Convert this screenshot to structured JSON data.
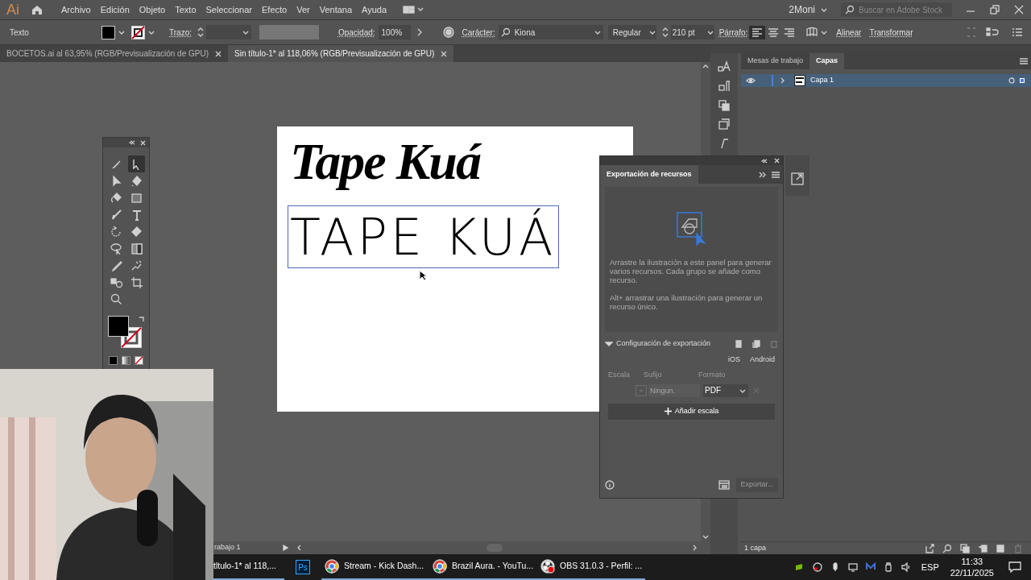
{
  "app_logo": "Ai",
  "menu": [
    "Archivo",
    "Edición",
    "Objeto",
    "Texto",
    "Seleccionar",
    "Efecto",
    "Ver",
    "Ventana",
    "Ayuda"
  ],
  "workspace": "2Moni",
  "stock_search": {
    "placeholder": "Buscar en Adobe Stock"
  },
  "control_bar": {
    "selection": "Texto",
    "stroke_label": "Trazo:",
    "opacity_label": "Opacidad:",
    "opacity": "100%",
    "character_label": "Carácter:",
    "font": "Kiona",
    "style": "Regular",
    "size": "210 pt",
    "paragraph_label": "Párrafo:",
    "align": [
      {
        "kind": "left",
        "selected": true
      },
      {
        "kind": "center",
        "selected": false
      },
      {
        "kind": "right",
        "selected": false
      }
    ],
    "align_link": "Alinear",
    "transform_link": "Transformar"
  },
  "doc_tabs": [
    {
      "label": "BOCETOS.ai al 63,95% (RGB/Previsualización de GPU)",
      "selected": false
    },
    {
      "label": "Sin título-1* al 118,06% (RGB/Previsualización de GPU)",
      "selected": true
    }
  ],
  "artboard": {
    "script_title": "Tape Kuá",
    "caps_title": "TAPE KUÁ"
  },
  "tools": [
    {
      "kind": "shaper",
      "selected": false
    },
    {
      "kind": "direct",
      "selected": true
    },
    {
      "kind": "select",
      "selected": false
    },
    {
      "kind": "pen",
      "selected": false
    },
    {
      "kind": "curvature",
      "selected": false
    },
    {
      "kind": "rect",
      "selected": false
    },
    {
      "kind": "brush",
      "selected": false
    },
    {
      "kind": "type",
      "selected": false
    },
    {
      "kind": "rotate",
      "selected": false
    },
    {
      "kind": "eraser",
      "selected": false
    },
    {
      "kind": "lasso",
      "selected": false
    },
    {
      "kind": "gradient",
      "selected": false
    },
    {
      "kind": "eyedropper",
      "selected": false
    },
    {
      "kind": "puppet",
      "selected": false
    },
    {
      "kind": "blend",
      "selected": false
    },
    {
      "kind": "crop",
      "selected": false
    },
    {
      "kind": "zoom",
      "selected": false
    }
  ],
  "layers_panel": {
    "tabs": [
      {
        "label": "Mesas de trabajo",
        "selected": false
      },
      {
        "label": "Capas",
        "selected": true
      }
    ],
    "layers": [
      {
        "name": "Capa 1",
        "visible": true,
        "expanded": false,
        "selected": true
      }
    ],
    "count": "1 capa"
  },
  "export_panel": {
    "title": "Exportación de recursos",
    "hint_1": "Arrastre la ilustración a este panel para generar varios recursos. Cada grupo se añade como recurso.",
    "hint_2": "Alt+ arrastrar una ilustración para generar un recurso único.",
    "settings_title": "Configuración de exportación",
    "presets": [
      "iOS",
      "Android"
    ],
    "columns": [
      "Escala",
      "Sufijo",
      "Formato"
    ],
    "suffix_placeholder": "Ningun.",
    "format": "PDF",
    "add_scale": "Añadir escala",
    "export_button": "Exportar...",
    "export_disabled": true
  },
  "status_bar": {
    "artboard": "rabajo 1"
  },
  "taskbar": [
    {
      "kind": "ai",
      "label": "tltulo-1* al 118,..."
    },
    {
      "kind": "ps",
      "label": "Ps"
    },
    {
      "kind": "chrome",
      "label": "Stream - Kick Dash..."
    },
    {
      "kind": "chrome",
      "label": "Brazil Aura. - YouTu..."
    },
    {
      "kind": "obs",
      "label": "OBS 31.0.3 - Perfil: ..."
    }
  ],
  "tray": {
    "language": "ESP",
    "time": "11:33",
    "date": "22/11/2025"
  }
}
